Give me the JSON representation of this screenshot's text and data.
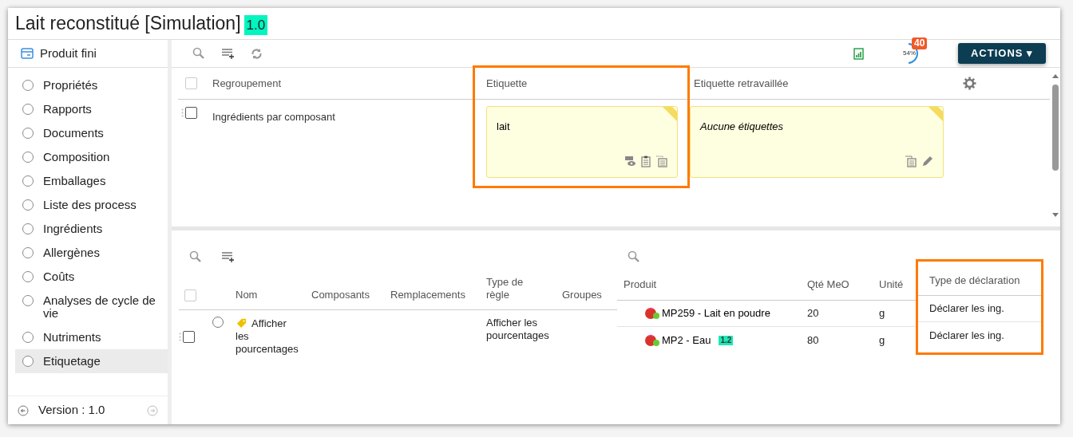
{
  "title": "Lait reconstitué [Simulation]",
  "version": "1.0",
  "sidebar": {
    "header": "Produit fini",
    "items": [
      {
        "label": "Propriétés",
        "selected": false
      },
      {
        "label": "Rapports",
        "selected": false
      },
      {
        "label": "Documents",
        "selected": false
      },
      {
        "label": "Composition",
        "selected": false
      },
      {
        "label": "Emballages",
        "selected": false
      },
      {
        "label": "Liste des process",
        "selected": false
      },
      {
        "label": "Ingrédients",
        "selected": false
      },
      {
        "label": "Allergènes",
        "selected": false
      },
      {
        "label": "Coûts",
        "selected": false
      },
      {
        "label": "Analyses de cycle de vie",
        "selected": false
      },
      {
        "label": "Nutriments",
        "selected": false
      },
      {
        "label": "Etiquetage",
        "selected": true
      }
    ],
    "footer": "Version : 1.0"
  },
  "toolbar": {
    "progress": {
      "reading": "54%"
    },
    "badge": "40",
    "actions": "ACTIONS ▾"
  },
  "labels_table": {
    "columns": [
      {
        "label": "Regroupement",
        "highlighted": false
      },
      {
        "label": "Etiquette",
        "highlighted": true
      },
      {
        "label": "Etiquette retravaillée",
        "highlighted": false
      }
    ],
    "all_checked": false,
    "rows": [
      {
        "checked": false,
        "group": "Ingrédients par composant",
        "label": "lait",
        "reworked": "Aucune étiquettes"
      }
    ]
  },
  "rules_table": {
    "all_checked": false,
    "columns": [
      "Nom",
      "Composants",
      "Remplacements",
      "Type de règle",
      "Groupes"
    ],
    "rows": [
      {
        "checked": false,
        "selected": false,
        "name": "Afficher les pourcentages",
        "rule_type": "Afficher les pourcentages"
      }
    ]
  },
  "components_table": {
    "columns": [
      {
        "label": "Produit",
        "highlighted": false
      },
      {
        "label": "Qté MeO",
        "highlighted": false
      },
      {
        "label": "Unité",
        "highlighted": false
      },
      {
        "label": "Type de déclaration",
        "highlighted": true
      }
    ],
    "rows": [
      {
        "product": "MP259 - Lait en poudre",
        "qty": "20",
        "unit": "g",
        "declaration": "Déclarer les ing."
      },
      {
        "product": "MP2 - Eau",
        "version": "1.2",
        "qty": "80",
        "unit": "g",
        "declaration": "Déclarer les ing."
      }
    ]
  }
}
